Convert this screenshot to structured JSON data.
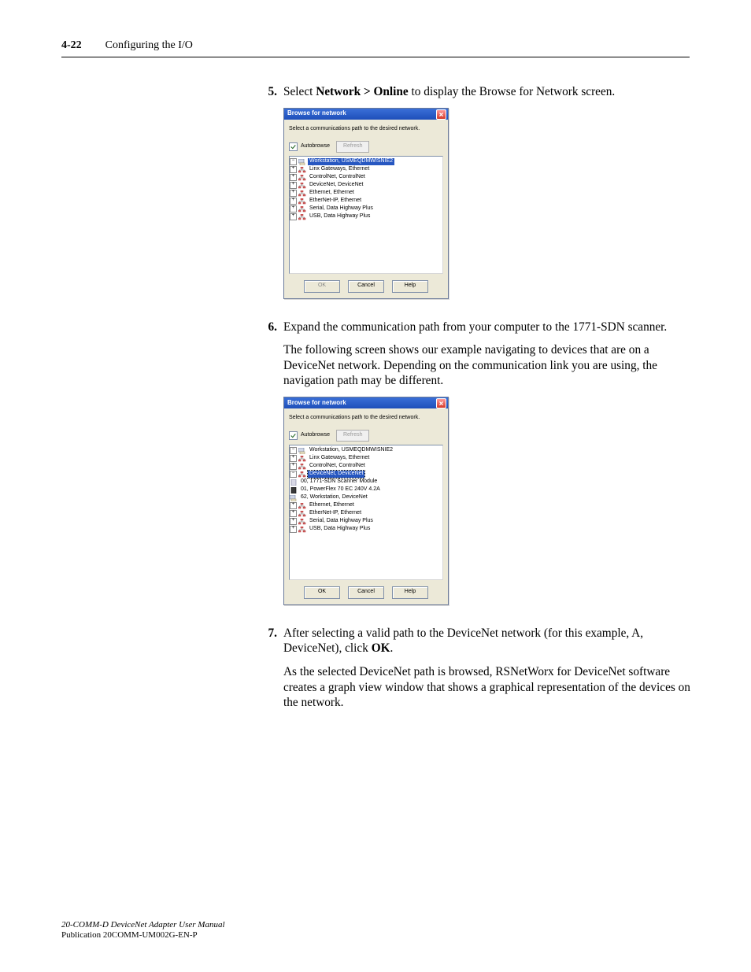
{
  "header": {
    "pageNumber": "4-22",
    "chapterTitle": "Configuring the I/O"
  },
  "footer": {
    "manualTitle": "20-COMM-D DeviceNet Adapter User Manual",
    "publication": "Publication 20COMM-UM002G-EN-P"
  },
  "steps": {
    "s5": {
      "num": "5.",
      "pre": "Select ",
      "bold": "Network > Online",
      "post": " to display the Browse for Network screen."
    },
    "s6": {
      "num": "6.",
      "p1": "Expand the communication path from your computer to the 1771-SDN scanner.",
      "p2": "The following screen shows our example navigating to devices that are on a DeviceNet network. Depending on the communication link you are using, the navigation path may be different."
    },
    "s7": {
      "num": "7.",
      "p1pre": "After selecting a valid path to the DeviceNet network (for this example, A, DeviceNet), click ",
      "p1bold": "OK",
      "p1post": ".",
      "p2": "As the selected DeviceNet path is browsed, RSNetWorx for DeviceNet software creates a graph view window that shows a graphical representation of the devices on the network."
    }
  },
  "dialog": {
    "title": "Browse for network",
    "instruction": "Select a communications path to the desired network.",
    "autobrowseLabel": "Autobrowse",
    "refreshLabel": "Refresh",
    "buttons": {
      "ok": "OK",
      "cancel": "Cancel",
      "help": "Help"
    },
    "tree1": {
      "root": "Workstation, USMEQDMWISNIE2",
      "items": [
        "Linx Gateways, Ethernet",
        "ControlNet, ControlNet",
        "DeviceNet, DeviceNet",
        "Ethernet, Ethernet",
        "EtherNet-IP, Ethernet",
        "Serial, Data Highway Plus",
        "USB, Data Highway Plus"
      ]
    },
    "tree2": {
      "root": "Workstation, USMEQDMWISNIE2",
      "items": [
        {
          "label": "Linx Gateways, Ethernet",
          "type": "net",
          "twisty": "+"
        },
        {
          "label": "ControlNet, ControlNet",
          "type": "net",
          "twisty": "+"
        },
        {
          "label": "DeviceNet, DeviceNet",
          "type": "net",
          "twisty": "-",
          "selected": true,
          "children": [
            {
              "label": "00, 1771-SDN Scanner Module",
              "type": "dev"
            },
            {
              "label": "01, PowerFlex 70 EC 240V   4.2A",
              "type": "dev"
            },
            {
              "label": "62, Workstation, DeviceNet",
              "type": "ws"
            }
          ]
        },
        {
          "label": "Ethernet, Ethernet",
          "type": "net",
          "twisty": "+"
        },
        {
          "label": "EtherNet-IP, Ethernet",
          "type": "net",
          "twisty": "+"
        },
        {
          "label": "Serial, Data Highway Plus",
          "type": "net",
          "twisty": "+"
        },
        {
          "label": "USB, Data Highway Plus",
          "type": "net",
          "twisty": "+"
        }
      ]
    }
  }
}
